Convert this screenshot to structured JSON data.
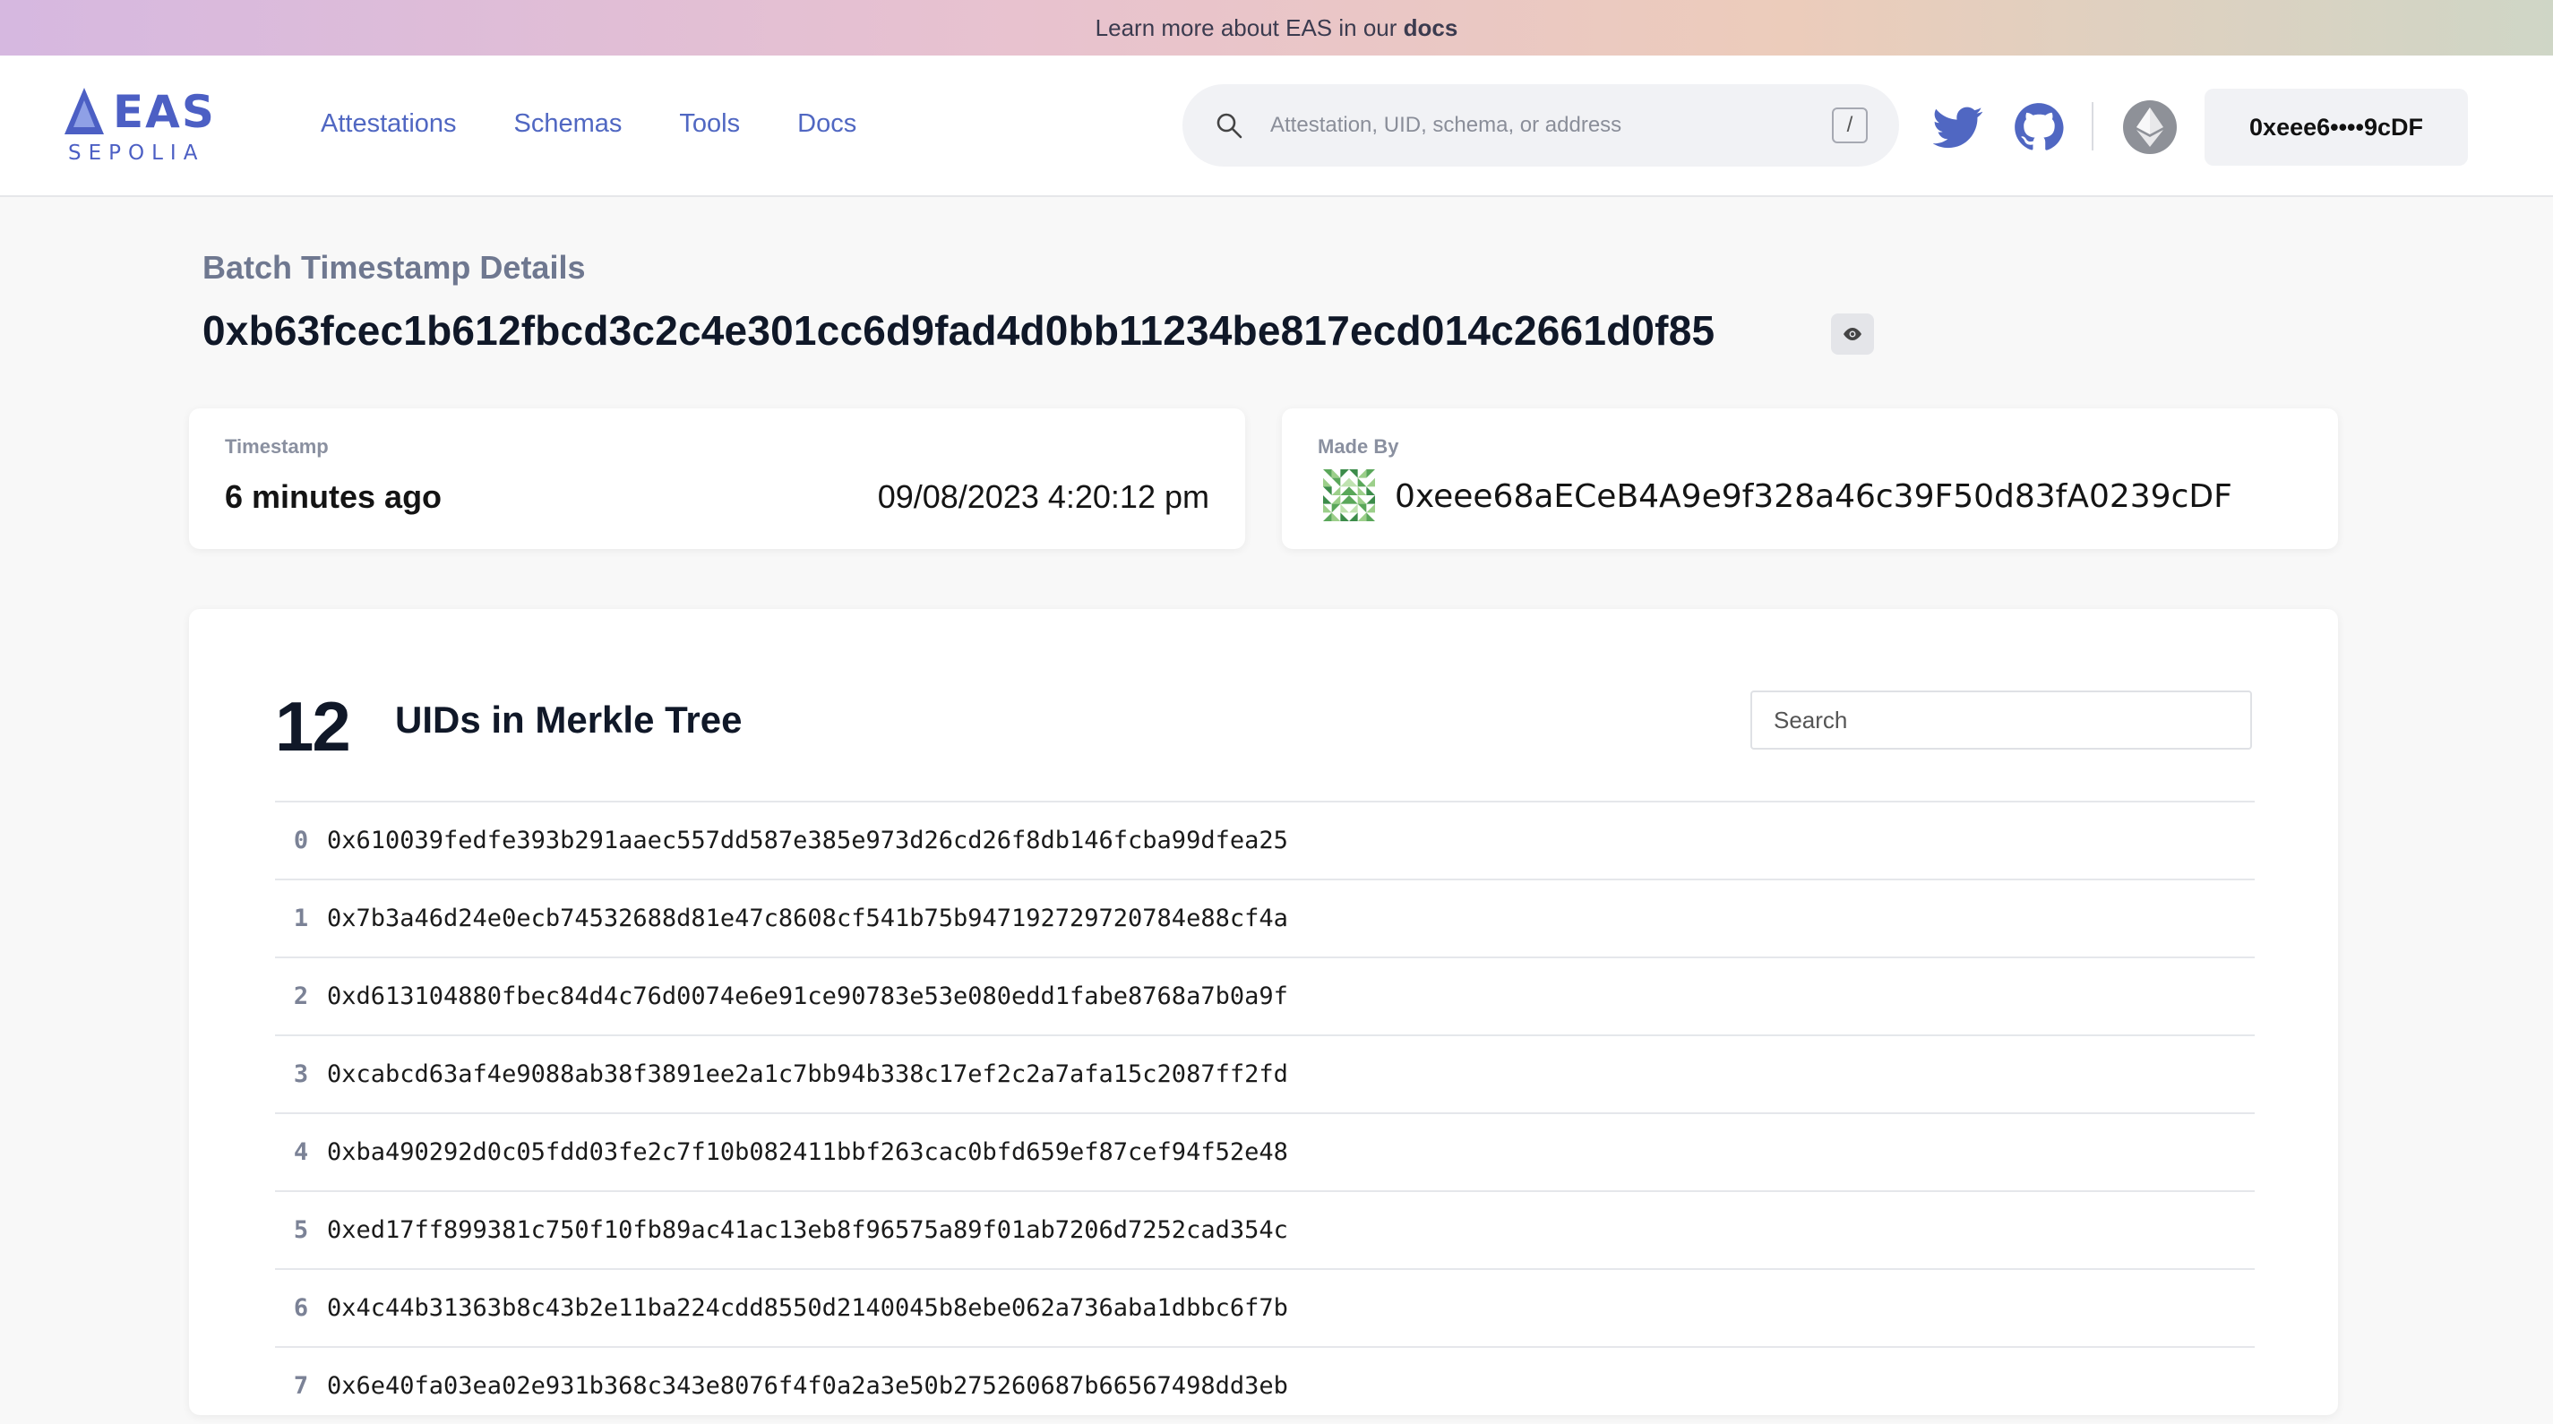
{
  "banner": {
    "prefix": "Learn more about EAS in our ",
    "link": "docs"
  },
  "logo": {
    "word": "EAS",
    "network": "SEPOLIA"
  },
  "nav": {
    "items": [
      "Attestations",
      "Schemas",
      "Tools",
      "Docs"
    ]
  },
  "search": {
    "placeholder": "Attestation, UID, schema, or address",
    "shortcut": "/"
  },
  "icons": {
    "twitter": "twitter-icon",
    "github": "github-icon",
    "network": "ethereum-icon",
    "accent": "#5067c2"
  },
  "wallet": {
    "label": "0xeee6••••9cDF"
  },
  "page": {
    "subtitle": "Batch Timestamp Details",
    "uid": "0xb63fcec1b612fbcd3c2c4e301cc6d9fad4d0bb11234be817ecd014c2661d0f85"
  },
  "timestamp_card": {
    "label": "Timestamp",
    "relative": "6 minutes ago",
    "absolute": "09/08/2023 4:20:12 pm"
  },
  "made_by_card": {
    "label": "Made By",
    "address": "0xeee68aECeB4A9e9f328a46c39F50d83fA0239cDF"
  },
  "merkle": {
    "count": "12",
    "title": "UIDs in Merkle Tree",
    "search_placeholder": "Search",
    "rows": [
      {
        "index": "0",
        "uid": "0x610039fedfe393b291aaec557dd587e385e973d26cd26f8db146fcba99dfea25"
      },
      {
        "index": "1",
        "uid": "0x7b3a46d24e0ecb74532688d81e47c8608cf541b75b947192729720784e88cf4a"
      },
      {
        "index": "2",
        "uid": "0xd613104880fbec84d4c76d0074e6e91ce90783e53e080edd1fabe8768a7b0a9f"
      },
      {
        "index": "3",
        "uid": "0xcabcd63af4e9088ab38f3891ee2a1c7bb94b338c17ef2c2a7afa15c2087ff2fd"
      },
      {
        "index": "4",
        "uid": "0xba490292d0c05fdd03fe2c7f10b082411bbf263cac0bfd659ef87cef94f52e48"
      },
      {
        "index": "5",
        "uid": "0xed17ff899381c750f10fb89ac41ac13eb8f96575a89f01ab7206d7252cad354c"
      },
      {
        "index": "6",
        "uid": "0x4c44b31363b8c43b2e11ba224cdd8550d2140045b8ebe062a736aba1dbbc6f7b"
      },
      {
        "index": "7",
        "uid": "0x6e40fa03ea02e931b368c343e8076f4f0a2a3e50b275260687b66567498dd3eb"
      }
    ]
  }
}
